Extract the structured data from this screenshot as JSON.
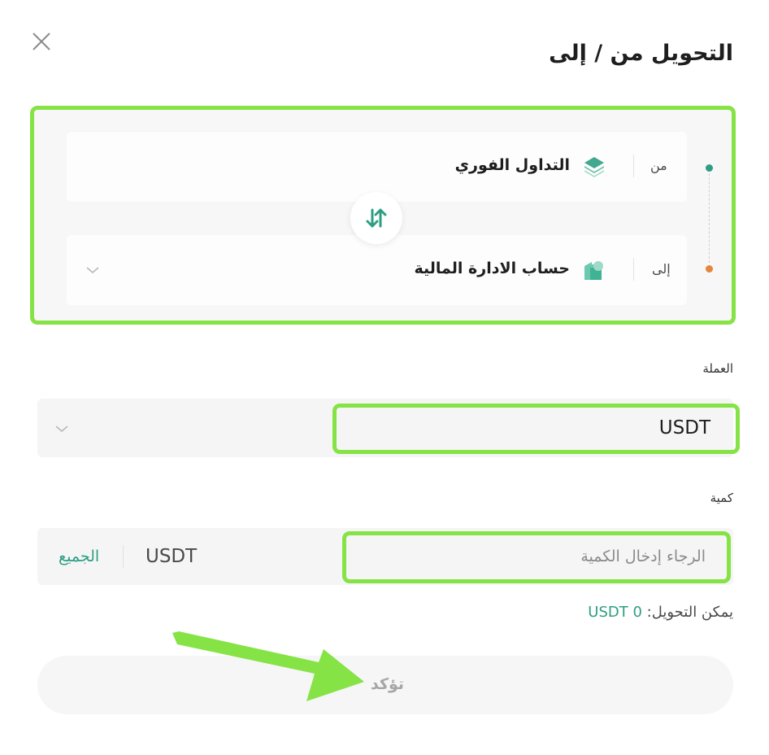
{
  "dialog": {
    "title": "التحويل من / إلى"
  },
  "transfer": {
    "from": {
      "label": "من",
      "account": "التداول الفوري",
      "icon": "layers-icon"
    },
    "to": {
      "label": "إلى",
      "account": "حساب الادارة المالية",
      "icon": "finance-account-icon"
    },
    "swap_icon": "swap-arrows-icon"
  },
  "currency": {
    "label": "العملة",
    "selected": "USDT"
  },
  "amount": {
    "label": "كمية",
    "placeholder": "الرجاء إدخال الكمية",
    "unit": "USDT",
    "max_label": "الجميع"
  },
  "available": {
    "label": "يمكن التحويل:",
    "value": "USDT 0"
  },
  "confirm": {
    "label": "تؤكد"
  },
  "colors": {
    "accent": "#2d9e83",
    "highlight": "#86e345",
    "from_dot": "#2d9e83",
    "to_dot": "#e8853a"
  }
}
